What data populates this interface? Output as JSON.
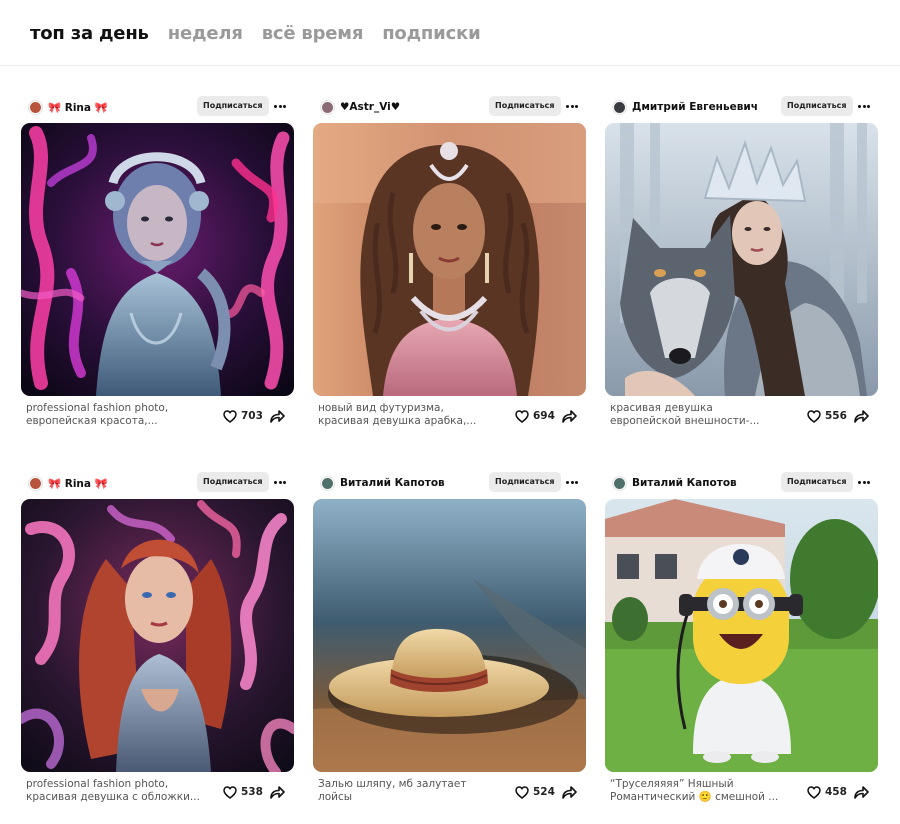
{
  "tabs": [
    {
      "label": "топ за день",
      "active": true
    },
    {
      "label": "неделя",
      "active": false
    },
    {
      "label": "всё время",
      "active": false
    },
    {
      "label": "подписки",
      "active": false
    }
  ],
  "cards": [
    {
      "author": "🎀 Rina 🎀",
      "subscribe_label": "Подписаться",
      "caption": [
        "professional fashion photo,",
        "европейская красота,..."
      ],
      "likes": "703",
      "avatar_color": "#b9543c",
      "image": "woman-octopus-neon"
    },
    {
      "author": "♥Astr_Vi♥",
      "subscribe_label": "Подписаться",
      "caption": [
        "новый вид футуризма,",
        "красивая девушка арабка,..."
      ],
      "likes": "694",
      "avatar_color": "#8a6a76",
      "image": "woman-arabic-jewelry"
    },
    {
      "author": "Дмитрий Евгеньевич",
      "subscribe_label": "Подписаться",
      "caption": [
        "красивая девушка",
        "европейской внешности-..."
      ],
      "likes": "556",
      "avatar_color": "#3a3a42",
      "image": "woman-with-wolf"
    },
    {
      "author": "🎀 Rina 🎀",
      "subscribe_label": "Подписаться",
      "caption": [
        "professional fashion photo,",
        "красивая девушка с обложки..."
      ],
      "likes": "538",
      "avatar_color": "#b9543c",
      "image": "redhead-octopus-neon"
    },
    {
      "author": "Виталий Капотов",
      "subscribe_label": "Подписаться",
      "caption": [
        "Залью шляпу, мб залутает",
        "лойсы"
      ],
      "likes": "524",
      "avatar_color": "#4f6f6a",
      "image": "straw-hat"
    },
    {
      "author": "Виталий Капотов",
      "subscribe_label": "Подписаться",
      "caption": [
        "“Труселяяяя” Няшный",
        "Романтический 🙂 смешной ..."
      ],
      "likes": "458",
      "avatar_color": "#4f6f6a",
      "image": "minion-doctor"
    }
  ],
  "icons": {
    "like": "heart-icon",
    "share": "share-arrow-icon",
    "more": "more-dots-icon"
  }
}
